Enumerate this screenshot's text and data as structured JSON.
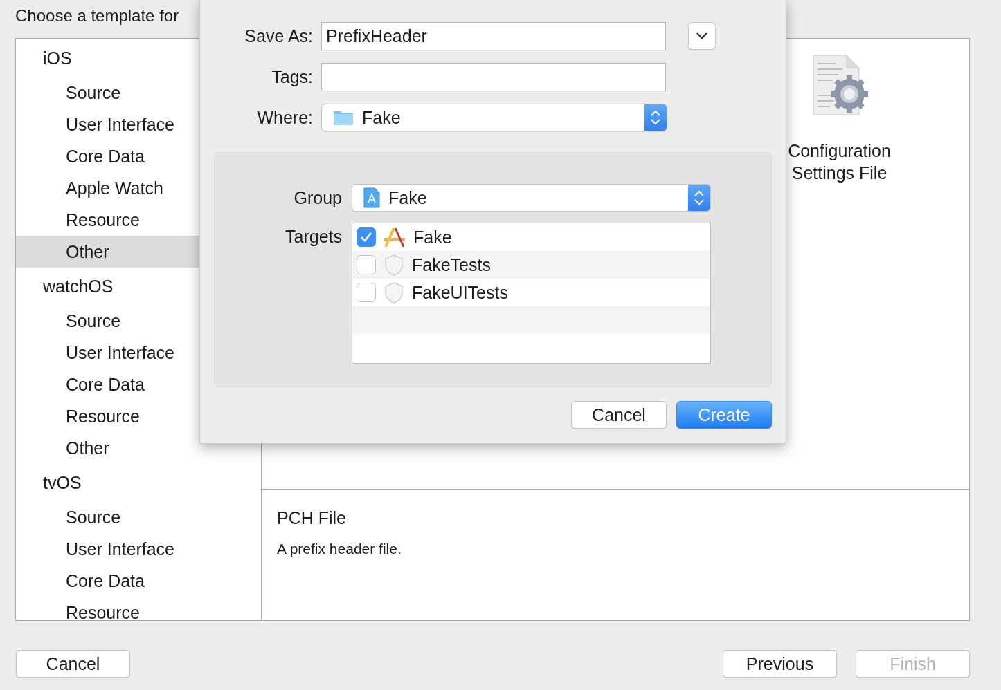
{
  "background_window": {
    "title": "Choose a template for",
    "sidebar": {
      "sections": [
        {
          "label": "iOS",
          "items": [
            {
              "label": "Source",
              "selected": false
            },
            {
              "label": "User Interface",
              "selected": false
            },
            {
              "label": "Core Data",
              "selected": false
            },
            {
              "label": "Apple Watch",
              "selected": false
            },
            {
              "label": "Resource",
              "selected": false
            },
            {
              "label": "Other",
              "selected": true
            }
          ]
        },
        {
          "label": "watchOS",
          "items": [
            {
              "label": "Source",
              "selected": false
            },
            {
              "label": "User Interface",
              "selected": false
            },
            {
              "label": "Core Data",
              "selected": false
            },
            {
              "label": "Resource",
              "selected": false
            },
            {
              "label": "Other",
              "selected": false
            }
          ]
        },
        {
          "label": "tvOS",
          "items": [
            {
              "label": "Source",
              "selected": false
            },
            {
              "label": "User Interface",
              "selected": false
            },
            {
              "label": "Core Data",
              "selected": false
            },
            {
              "label": "Resource",
              "selected": false
            }
          ]
        }
      ]
    },
    "templates": [
      {
        "label": "Configuration Settings File"
      }
    ],
    "description": {
      "title": "PCH File",
      "text": "A prefix header file."
    },
    "buttons": [
      {
        "label": "Cancel",
        "disabled": false
      },
      {
        "label": "Previous",
        "disabled": false
      },
      {
        "label": "Finish",
        "disabled": true
      }
    ]
  },
  "sheet": {
    "save_as": {
      "label": "Save As:",
      "value": "PrefixHeader"
    },
    "tags": {
      "label": "Tags:"
    },
    "where": {
      "label": "Where:",
      "value": "Fake"
    },
    "group": {
      "label": "Group",
      "value": "Fake"
    },
    "targets": {
      "label": "Targets",
      "items": [
        {
          "label": "Fake",
          "checked": true,
          "kind": "app"
        },
        {
          "label": "FakeTests",
          "checked": false,
          "kind": "test"
        },
        {
          "label": "FakeUITests",
          "checked": false,
          "kind": "test"
        }
      ]
    },
    "buttons": [
      {
        "label": "Cancel",
        "default": false
      },
      {
        "label": "Create",
        "default": true
      }
    ]
  }
}
